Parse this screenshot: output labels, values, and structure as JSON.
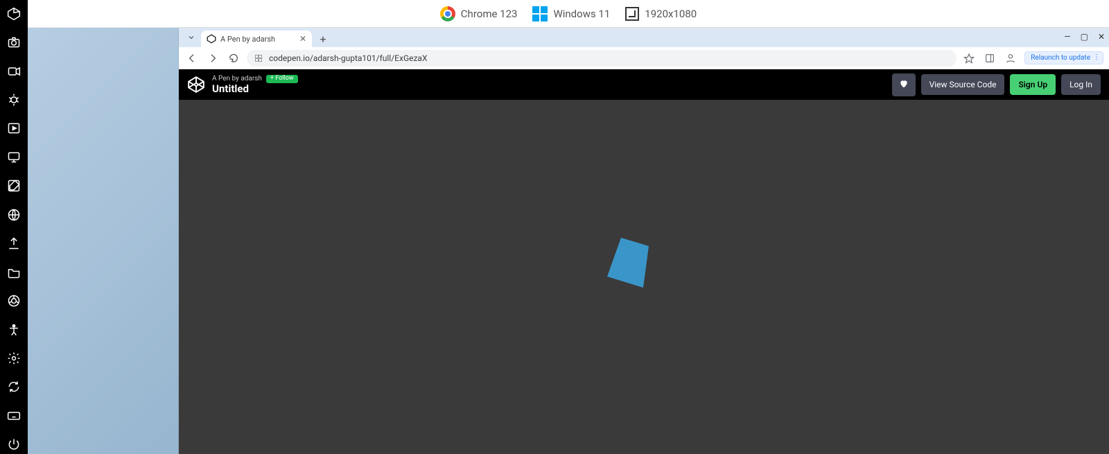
{
  "meta": {
    "browser": "Chrome 123",
    "os": "Windows 11",
    "resolution": "1920x1080"
  },
  "browser": {
    "tab_title": "A Pen by adarsh",
    "url": "codepen.io/adarsh-gupta101/full/ExGezaX",
    "relaunch_label": "Relaunch to update"
  },
  "codepen": {
    "byline": "A Pen by adarsh",
    "follow_label": "+ Follow",
    "title": "Untitled",
    "view_source": "View Source Code",
    "signup": "Sign Up",
    "login": "Log In"
  }
}
